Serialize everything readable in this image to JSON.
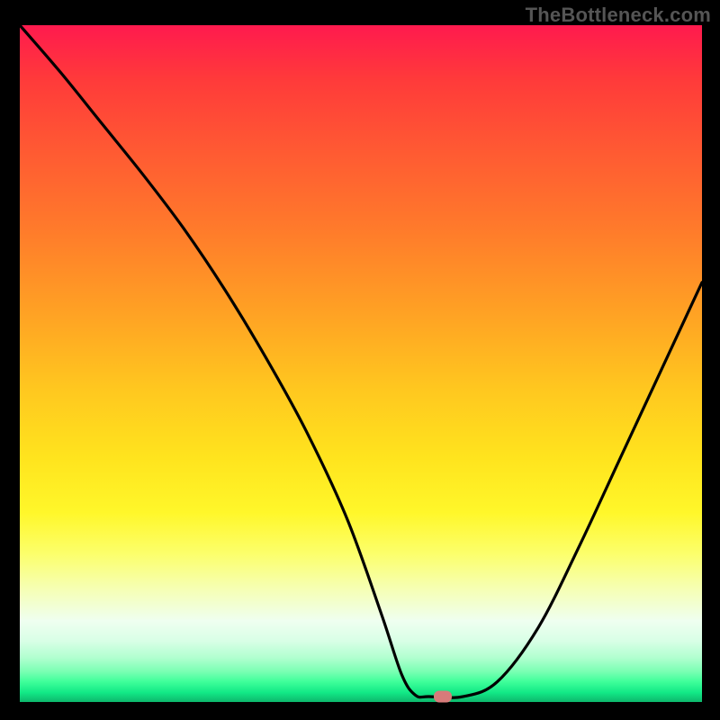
{
  "watermark": "TheBottleneck.com",
  "colors": {
    "frame": "#000000",
    "curve": "#000000",
    "marker": "#d77b7a",
    "watermark_text": "#555555"
  },
  "chart_data": {
    "type": "line",
    "title": "",
    "xlabel": "",
    "ylabel": "",
    "xlim": [
      0,
      100
    ],
    "ylim": [
      0,
      100
    ],
    "grid": false,
    "legend": false,
    "x": [
      0,
      6,
      12,
      18,
      24,
      30,
      36,
      42,
      48,
      53,
      56,
      58,
      60,
      65,
      70,
      76,
      82,
      88,
      94,
      100
    ],
    "values": [
      100,
      93,
      85.5,
      78,
      70,
      61,
      51,
      40,
      27,
      13,
      4,
      1,
      0.8,
      0.8,
      3,
      11,
      23,
      36,
      49,
      62
    ],
    "marker": {
      "x": 62,
      "y": 0.8
    },
    "background_gradient_domain": [
      0,
      100
    ],
    "background_gradient_meaning": "bottleneck percentage (green=low at bottom, red=high at top)"
  }
}
